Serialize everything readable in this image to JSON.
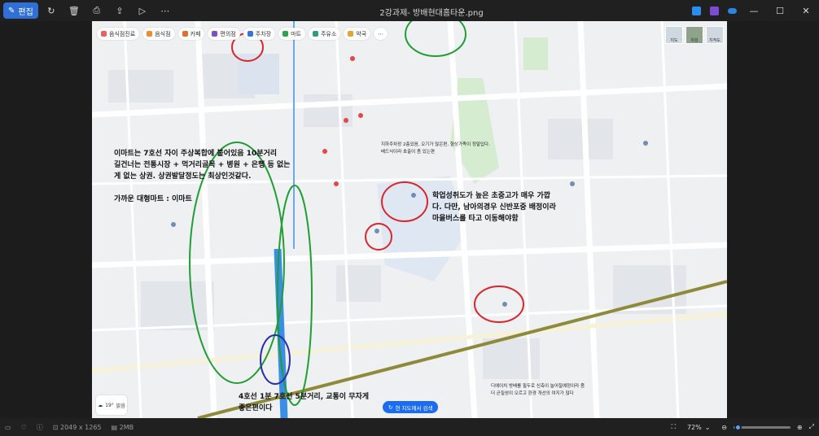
{
  "titlebar": {
    "edit_label": "편집",
    "filename": "2강과제- 방배현대홈타운.png"
  },
  "map": {
    "toolbar": [
      "음식점",
      "카페",
      "편의점",
      "주차장",
      "마트",
      "주유소",
      "약국"
    ],
    "toolbar_first": "음식점진료",
    "layers": [
      "지도",
      "위성",
      "지적도"
    ],
    "search_area": "현 지도에서 검색",
    "weather_temp": "19°",
    "weather_label": "맑음"
  },
  "annotations": {
    "emart": [
      "이마트는 7호선 자이 주상복합에 붙어있음 10분거리",
      "길건너는 전통시장 + 먹거리골목 + 병원 + 은행 등 없는",
      "게 없는 상권. 상권발달정도는 최상인것같다.",
      "",
      "가까운 대형마트 : 이마트"
    ],
    "school": [
      "학업성취도가 높은 초중고가 매우 가깝",
      "다. 다만, 남아의경우 신반포중 배정이라",
      "마을버스를 타고 이동해야함"
    ],
    "subway": [
      "4호선 1분 7호선 5분거리, 교통이 무자게",
      "좋은편이다"
    ],
    "parking": [
      "지하주차장 2층있음, 오기가 많은편, 향상가족이 정말입다.",
      "배드식이라 호출이 좀 있는편"
    ],
    "redevelop": [
      "디에이치 방배를 필두로 신축이 늘어질예정이라 좀",
      "더 균질성이 오르고 환경 개선의 여지가 많다"
    ]
  },
  "statusbar": {
    "dimensions": "2049 x 1265",
    "filesize": "2MB",
    "zoom": "72%"
  },
  "zoom_level": 0.72
}
